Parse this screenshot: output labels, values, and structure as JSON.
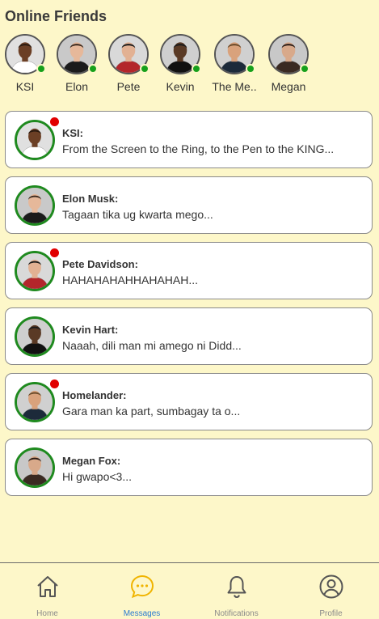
{
  "online_friends": {
    "title": "Online Friends",
    "friends": [
      {
        "name": "KSI",
        "skin": "#6b3f25",
        "hair": "#2a1a10",
        "shirt": "#ffffff",
        "bg": "#e0e0e0"
      },
      {
        "name": "Elon",
        "skin": "#e6b89a",
        "hair": "#3b2a1f",
        "shirt": "#1b1b1b",
        "bg": "#c9c9c9"
      },
      {
        "name": "Pete",
        "skin": "#e2b193",
        "hair": "#1a1a1a",
        "shirt": "#b3262b",
        "bg": "#d9d9d9"
      },
      {
        "name": "Kevin",
        "skin": "#5a3a25",
        "hair": "#1a1a1a",
        "shirt": "#111111",
        "bg": "#cfcfcf"
      },
      {
        "name": "The Me..",
        "skin": "#d9a27c",
        "hair": "#6a4a2a",
        "shirt": "#1c2a3a",
        "bg": "#d0d0d0"
      },
      {
        "name": "Megan",
        "skin": "#d8a98a",
        "hair": "#2b1c16",
        "shirt": "#3a2a22",
        "bg": "#c8c8c8"
      }
    ]
  },
  "chats": [
    {
      "name": "KSI:",
      "message": "From the Screen to the Ring, to the Pen to the KING...",
      "unread": true,
      "skin": "#6b3f25",
      "hair": "#2a1a10",
      "shirt": "#ffffff",
      "bg": "#e0e0e0"
    },
    {
      "name": "Elon Musk:",
      "message": "Tagaan tika ug kwarta mego...",
      "unread": false,
      "skin": "#e6b89a",
      "hair": "#3b2a1f",
      "shirt": "#1b1b1b",
      "bg": "#c9c9c9"
    },
    {
      "name": "Pete Davidson:",
      "message": "HAHAHAHAHHAHAHAH...",
      "unread": true,
      "skin": "#e2b193",
      "hair": "#1a1a1a",
      "shirt": "#b3262b",
      "bg": "#d9d9d9"
    },
    {
      "name": "Kevin Hart:",
      "message": "Naaah, dili man mi amego ni Didd...",
      "unread": false,
      "skin": "#5a3a25",
      "hair": "#1a1a1a",
      "shirt": "#111111",
      "bg": "#cfcfcf"
    },
    {
      "name": "Homelander:",
      "message": "Gara man ka part, sumbagay ta o...",
      "unread": true,
      "skin": "#d9a27c",
      "hair": "#6a4a2a",
      "shirt": "#1c2a3a",
      "bg": "#d0d0d0"
    },
    {
      "name": "Megan Fox:",
      "message": "Hi gwapo<3...",
      "unread": false,
      "skin": "#d8a98a",
      "hair": "#2b1c16",
      "shirt": "#3a2a22",
      "bg": "#c8c8c8"
    }
  ],
  "colors": {
    "background": "#fdf7c9",
    "online_dot": "#16a01a",
    "unread_dot": "#e10000",
    "avatar_ring": "#1f8a1f",
    "active_tab": "#f0b400",
    "active_label": "#2a7bd0"
  },
  "nav": {
    "active": "messages",
    "items": [
      {
        "id": "home",
        "label": "Home",
        "icon": "home-icon"
      },
      {
        "id": "messages",
        "label": "Messages",
        "icon": "chat-bubble-icon"
      },
      {
        "id": "notifications",
        "label": "Notifications",
        "icon": "bell-icon"
      },
      {
        "id": "profile",
        "label": "Profile",
        "icon": "user-circle-icon"
      }
    ]
  }
}
